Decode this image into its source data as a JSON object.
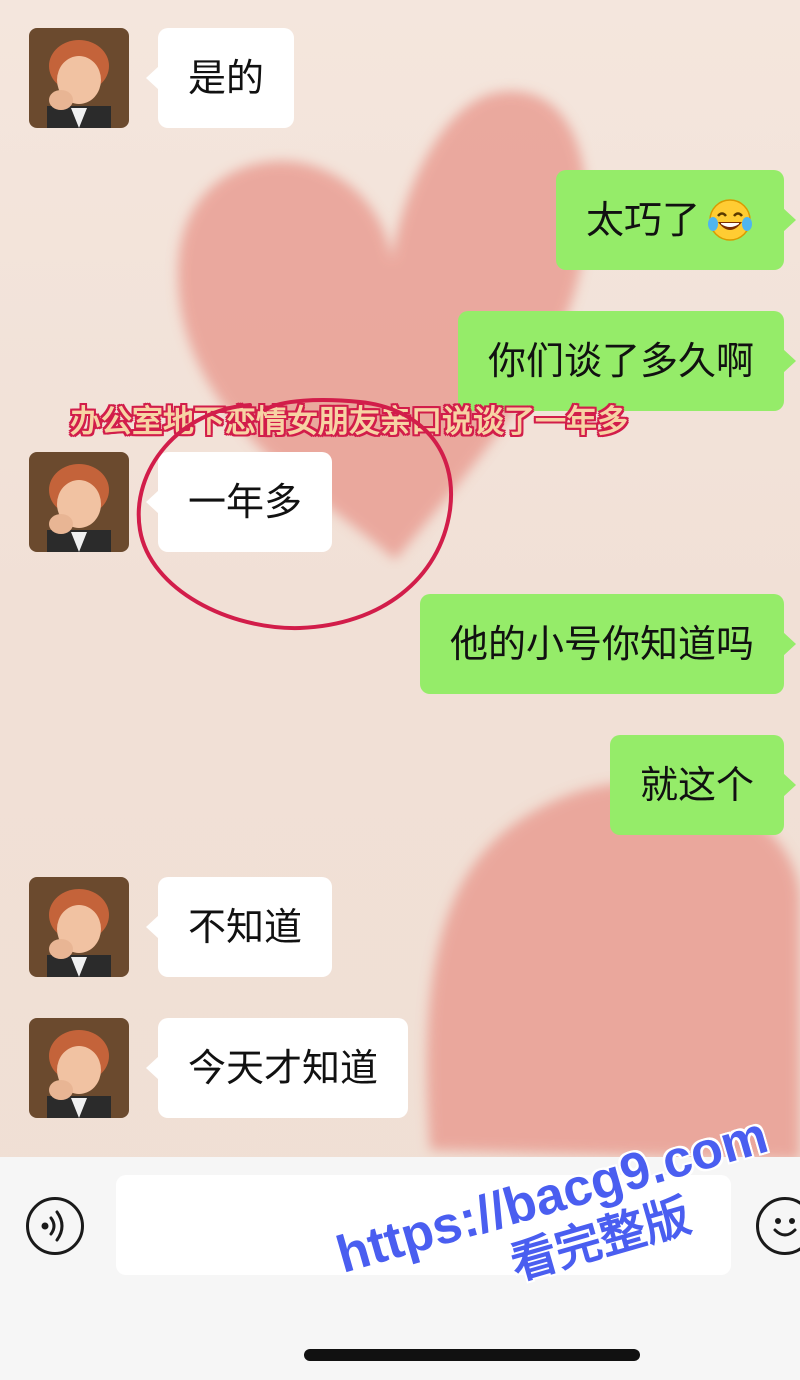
{
  "chat": {
    "messages": [
      {
        "side": "left",
        "text": "是的"
      },
      {
        "side": "right",
        "text": "太巧了",
        "emoji": "face-with-tears-of-joy-icon"
      },
      {
        "side": "right",
        "text": "你们谈了多久啊"
      },
      {
        "side": "left",
        "text": "一年多"
      },
      {
        "side": "right",
        "text": "他的小号你知道吗"
      },
      {
        "side": "right",
        "text": "就这个"
      },
      {
        "side": "left",
        "text": "不知道"
      },
      {
        "side": "left",
        "text": "今天才知道"
      }
    ]
  },
  "annotation": {
    "caption": "办公室地下恋情女朋友亲口说谈了一年多"
  },
  "input_bar": {
    "text_value": "",
    "voice_icon": "voice-input-icon",
    "emoji_icon": "smiley-face-icon"
  },
  "watermark": {
    "url": "https://bacg9.com",
    "subtitle": "看完整版"
  },
  "colors": {
    "bubble_sent": "#95ec69",
    "bubble_received": "#ffffff",
    "annotation_red": "#d21d4a",
    "watermark_blue": "#4a5ef0"
  }
}
